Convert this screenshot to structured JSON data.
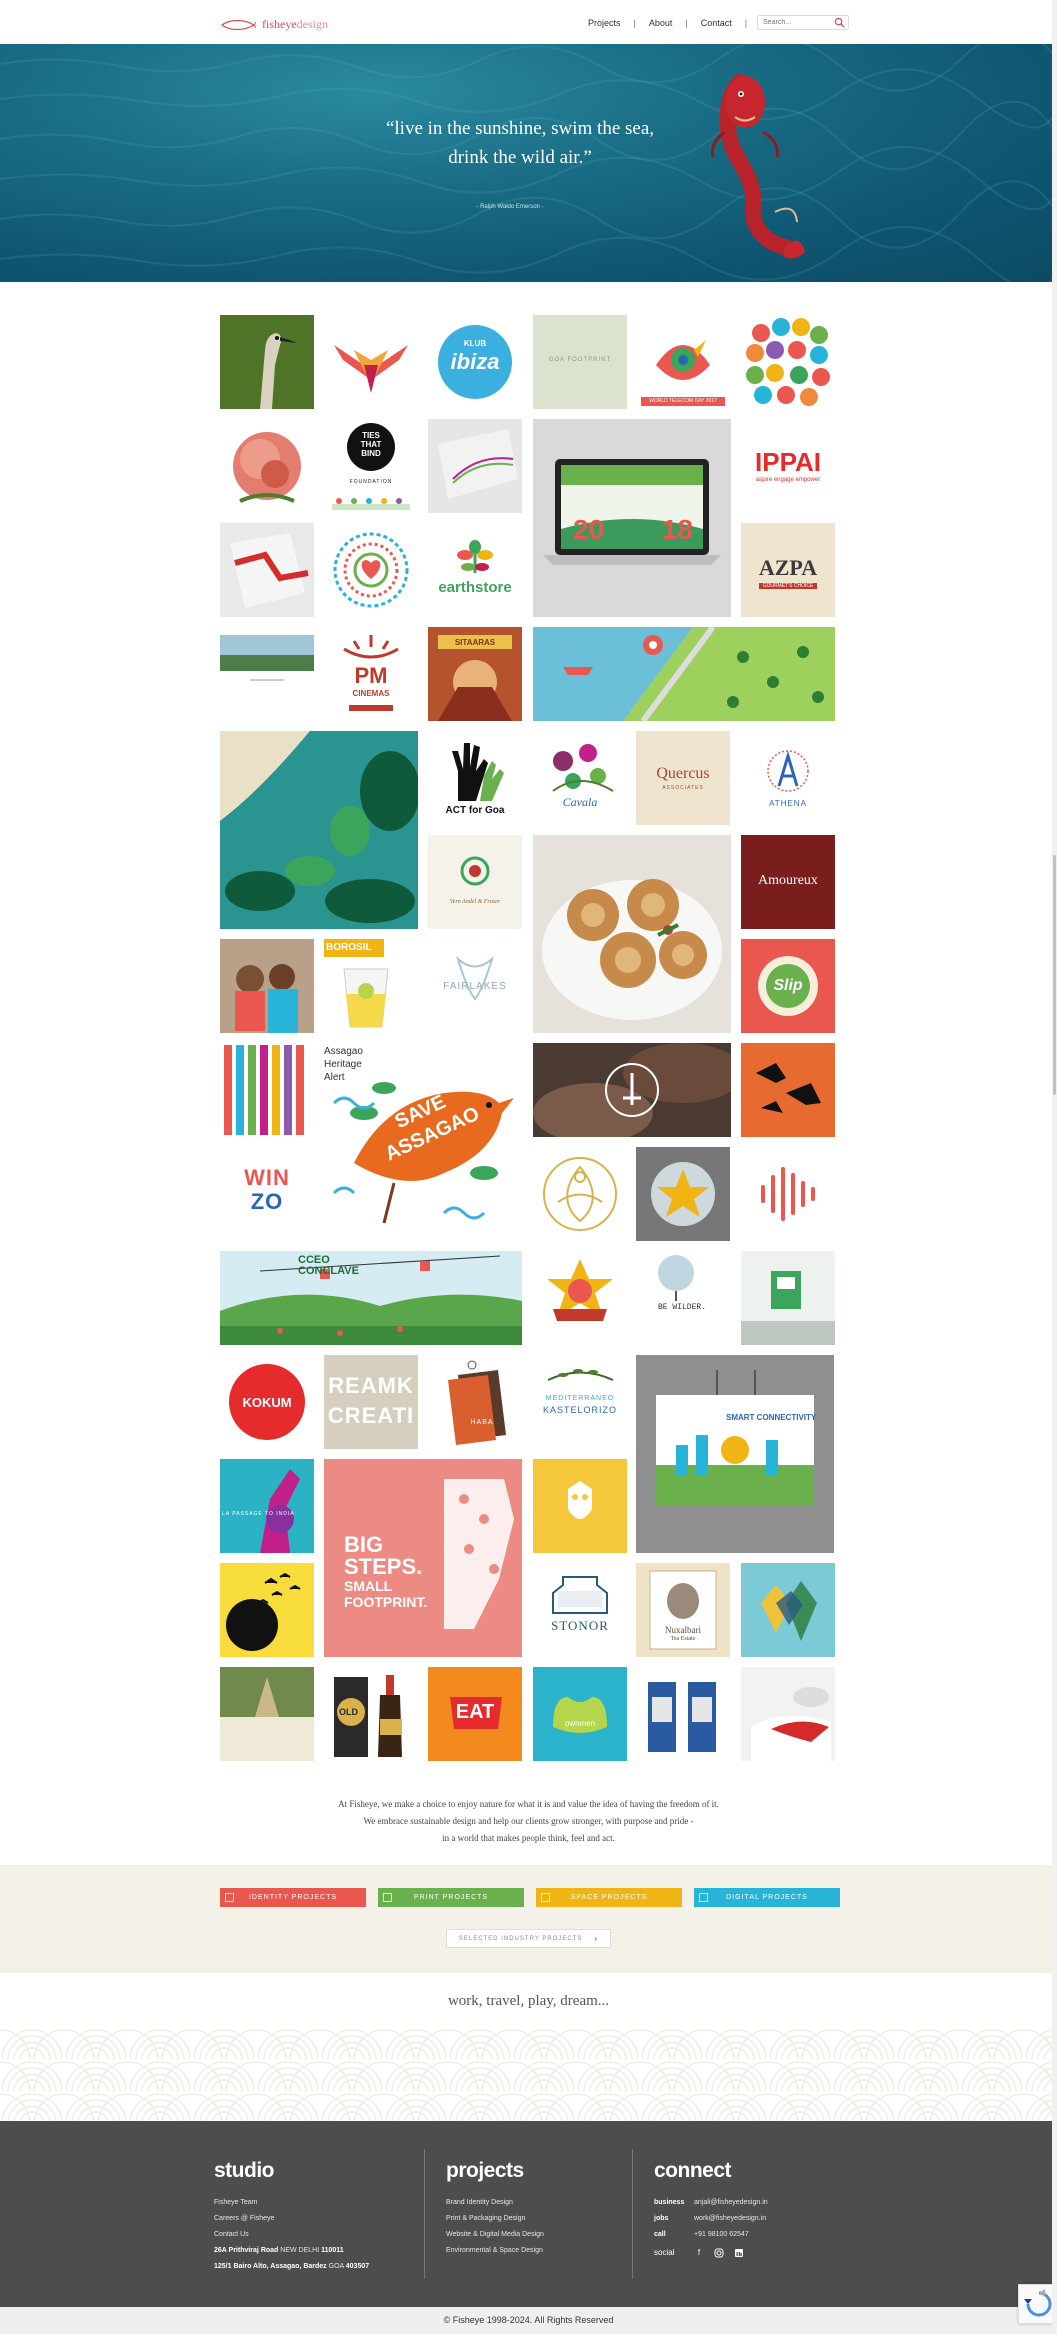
{
  "header": {
    "brand_main": "fisheye",
    "brand_sub": "design",
    "nav": [
      {
        "label": "Projects"
      },
      {
        "label": "About"
      },
      {
        "label": "Contact"
      }
    ],
    "search_placeholder": "Search..."
  },
  "hero": {
    "quote_line1": "“live in the sunshine, swim the sea,",
    "quote_line2": "drink the wild air.”",
    "attribution": "- Ralph Waldo Emerson -"
  },
  "tiles": {
    "klub_ibiza_1": "KLUB",
    "klub_ibiza_2": "ibiza",
    "goa_feat": "GOA FOOTPRINT",
    "world_tel": "WORLD TELECOM DAY 2017",
    "ties_1": "TIES",
    "ties_2": "THAT",
    "ties_3": "BIND",
    "ties_4": "FOUNDATION",
    "ippai": "IPPAI",
    "ippai_sub": "aspire engage empower",
    "year_left": "20",
    "year_right": "18",
    "earthstore": "earthstore",
    "azpa": "AZPA",
    "azpa_sub": "GOURMET'S CHOICE",
    "pm_1": "PM",
    "pm_2": "CINEMAS",
    "sitaaras": "SITAARAS",
    "act_goa": "ACT for Goa",
    "cavala": "Cavala",
    "quercus": "Quercus",
    "quercus_sub": "ASSOCIATES",
    "athena": "ATHENA",
    "vernandel": "Vern Andel & Fraser",
    "amoureux": "Amoureux",
    "borosil": "BOROSIL",
    "fairlakes": "FAIRLAKES",
    "slip": "Slip",
    "assagao_1": "Assagao",
    "assagao_2": "Heritage",
    "assagao_3": "Alert",
    "save_1": "SAVE",
    "save_2": "ASSAGAO",
    "winzo_1": "WIN",
    "winzo_2": "ZO",
    "cceo_1": "CCEO",
    "cceo_2": "CONCLAVE",
    "bewilder": "BE WILDER.",
    "kokum": "KOKUM",
    "reamk": "REAMK",
    "creati": "CREATI",
    "haba": "HABA",
    "mediterraneo_1": "MEDITERRANEO",
    "mediterraneo_2": "KASTELORIZO",
    "smart": "SMART CONNECTIVITY",
    "passage": "LA PASSAGE TO INDIA",
    "big_1": "BIG",
    "big_2": "STEPS.",
    "big_3": "SMALL",
    "big_4": "FOOTPRINT.",
    "stonor": "STONOR",
    "nuxalbari_1": "Nuxalbari",
    "nuxalbari_2": "Tea Estate",
    "old": "OLD",
    "eat": "EAT",
    "ownmen": "ownmen"
  },
  "tagline": {
    "line1": "At Fisheye, we make a choice to enjoy nature for what it is and value the idea of having the freedom of it.",
    "line2": "We embrace sustainable design and help our clients grow stronger, with purpose and pride -",
    "line3": "in a world that makes people think, feel and act."
  },
  "categories": [
    {
      "label": "IDENTITY PROJECTS",
      "color": "#e9574f"
    },
    {
      "label": "PRINT PROJECTS",
      "color": "#6ab04c"
    },
    {
      "label": "SPACE PROJECTS",
      "color": "#f0b414"
    },
    {
      "label": "DIGITAL PROJECTS",
      "color": "#27b4d8"
    }
  ],
  "industry_button": "SELECTED INDUSTRY PROJECTS",
  "motto": "work, travel, play, dream...",
  "footer": {
    "studio": {
      "title": "studio",
      "links": [
        "Fisheye Team",
        "Careers @ Fisheye",
        "Contact Us"
      ],
      "address1_pre": "26A Prithviraj Road ",
      "address1_city": "NEW DELHI ",
      "address1_pin": "110011",
      "address2_pre": "125/1 Bairo Alto, Assagao, Bardez ",
      "address2_city": "GOA ",
      "address2_pin": "403507"
    },
    "projects": {
      "title": "projects",
      "links": [
        "Brand Identity Design",
        "Print & Packaging Design",
        "Website & Digital Media Design",
        "Environmental & Space Design"
      ]
    },
    "connect": {
      "title": "connect",
      "rows": [
        {
          "k": "business",
          "v": "anjali@fisheyedesign.in"
        },
        {
          "k": "jobs",
          "v": "work@fisheyedesign.in"
        },
        {
          "k": "call",
          "v": "+91 98100 62547"
        }
      ],
      "social_label": "social",
      "social_icons": [
        "facebook-icon",
        "instagram-icon",
        "linkedin-icon"
      ]
    }
  },
  "copyright": "© Fisheye 1998-2024. All Rights Reserved"
}
